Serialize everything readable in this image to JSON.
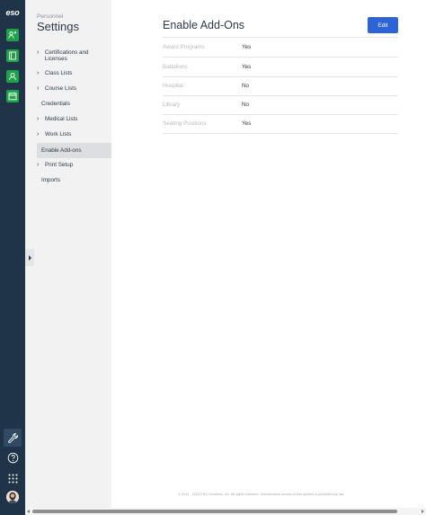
{
  "app": {
    "logo": "eso"
  },
  "rail": {
    "top_icons": [
      "people-icon",
      "book-icon",
      "user-badge-icon",
      "calendar-icon"
    ],
    "bottom_icons": [
      "wrench-icon",
      "help-icon",
      "grid-icon",
      "avatar"
    ],
    "accent_color": "#1fa34a",
    "background": "#1f3448"
  },
  "sidebar": {
    "section": "Personnel",
    "title": "Settings",
    "items": [
      {
        "label": "Certifications and Licenses",
        "expandable": true
      },
      {
        "label": "Class Lists",
        "expandable": true
      },
      {
        "label": "Course Lists",
        "expandable": true
      },
      {
        "label": "Credentials",
        "expandable": false
      },
      {
        "label": "Medical Lists",
        "expandable": true
      },
      {
        "label": "Work Lists",
        "expandable": true
      },
      {
        "label": "Enable Add-ons",
        "expandable": false,
        "selected": true
      },
      {
        "label": "Print Setup",
        "expandable": true
      },
      {
        "label": "Imports",
        "expandable": false
      }
    ]
  },
  "main": {
    "title": "Enable Add-Ons",
    "edit_label": "Edit",
    "rows": [
      {
        "key": "Award Programs",
        "value": "Yes"
      },
      {
        "key": "Battalions",
        "value": "Yes"
      },
      {
        "key": "Hospital",
        "value": "No"
      },
      {
        "key": "Library",
        "value": "No"
      },
      {
        "key": "Seating Positions",
        "value": "Yes"
      }
    ]
  },
  "footer": {
    "text": "© 2019 - 2023 ESO Solutions, Inc. All rights reserved. Unauthorized access to this system is prohibited by law."
  },
  "colors": {
    "primary_button": "#2c64d8",
    "sidebar_bg": "#f2f2f3"
  }
}
